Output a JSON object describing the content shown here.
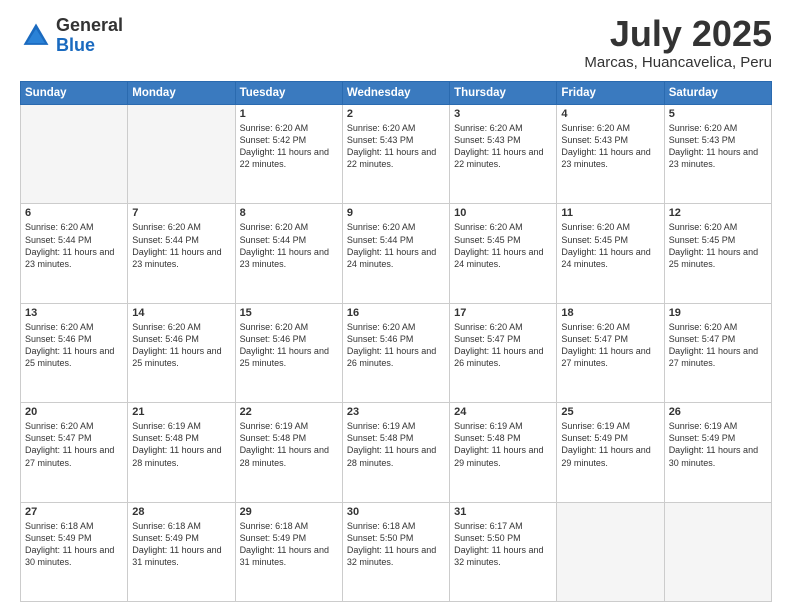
{
  "header": {
    "logo_general": "General",
    "logo_blue": "Blue",
    "month_title": "July 2025",
    "location": "Marcas, Huancavelica, Peru"
  },
  "weekdays": [
    "Sunday",
    "Monday",
    "Tuesday",
    "Wednesday",
    "Thursday",
    "Friday",
    "Saturday"
  ],
  "weeks": [
    [
      {
        "day": "",
        "text": ""
      },
      {
        "day": "",
        "text": ""
      },
      {
        "day": "1",
        "text": "Sunrise: 6:20 AM\nSunset: 5:42 PM\nDaylight: 11 hours and 22 minutes."
      },
      {
        "day": "2",
        "text": "Sunrise: 6:20 AM\nSunset: 5:43 PM\nDaylight: 11 hours and 22 minutes."
      },
      {
        "day": "3",
        "text": "Sunrise: 6:20 AM\nSunset: 5:43 PM\nDaylight: 11 hours and 22 minutes."
      },
      {
        "day": "4",
        "text": "Sunrise: 6:20 AM\nSunset: 5:43 PM\nDaylight: 11 hours and 23 minutes."
      },
      {
        "day": "5",
        "text": "Sunrise: 6:20 AM\nSunset: 5:43 PM\nDaylight: 11 hours and 23 minutes."
      }
    ],
    [
      {
        "day": "6",
        "text": "Sunrise: 6:20 AM\nSunset: 5:44 PM\nDaylight: 11 hours and 23 minutes."
      },
      {
        "day": "7",
        "text": "Sunrise: 6:20 AM\nSunset: 5:44 PM\nDaylight: 11 hours and 23 minutes."
      },
      {
        "day": "8",
        "text": "Sunrise: 6:20 AM\nSunset: 5:44 PM\nDaylight: 11 hours and 23 minutes."
      },
      {
        "day": "9",
        "text": "Sunrise: 6:20 AM\nSunset: 5:44 PM\nDaylight: 11 hours and 24 minutes."
      },
      {
        "day": "10",
        "text": "Sunrise: 6:20 AM\nSunset: 5:45 PM\nDaylight: 11 hours and 24 minutes."
      },
      {
        "day": "11",
        "text": "Sunrise: 6:20 AM\nSunset: 5:45 PM\nDaylight: 11 hours and 24 minutes."
      },
      {
        "day": "12",
        "text": "Sunrise: 6:20 AM\nSunset: 5:45 PM\nDaylight: 11 hours and 25 minutes."
      }
    ],
    [
      {
        "day": "13",
        "text": "Sunrise: 6:20 AM\nSunset: 5:46 PM\nDaylight: 11 hours and 25 minutes."
      },
      {
        "day": "14",
        "text": "Sunrise: 6:20 AM\nSunset: 5:46 PM\nDaylight: 11 hours and 25 minutes."
      },
      {
        "day": "15",
        "text": "Sunrise: 6:20 AM\nSunset: 5:46 PM\nDaylight: 11 hours and 25 minutes."
      },
      {
        "day": "16",
        "text": "Sunrise: 6:20 AM\nSunset: 5:46 PM\nDaylight: 11 hours and 26 minutes."
      },
      {
        "day": "17",
        "text": "Sunrise: 6:20 AM\nSunset: 5:47 PM\nDaylight: 11 hours and 26 minutes."
      },
      {
        "day": "18",
        "text": "Sunrise: 6:20 AM\nSunset: 5:47 PM\nDaylight: 11 hours and 27 minutes."
      },
      {
        "day": "19",
        "text": "Sunrise: 6:20 AM\nSunset: 5:47 PM\nDaylight: 11 hours and 27 minutes."
      }
    ],
    [
      {
        "day": "20",
        "text": "Sunrise: 6:20 AM\nSunset: 5:47 PM\nDaylight: 11 hours and 27 minutes."
      },
      {
        "day": "21",
        "text": "Sunrise: 6:19 AM\nSunset: 5:48 PM\nDaylight: 11 hours and 28 minutes."
      },
      {
        "day": "22",
        "text": "Sunrise: 6:19 AM\nSunset: 5:48 PM\nDaylight: 11 hours and 28 minutes."
      },
      {
        "day": "23",
        "text": "Sunrise: 6:19 AM\nSunset: 5:48 PM\nDaylight: 11 hours and 28 minutes."
      },
      {
        "day": "24",
        "text": "Sunrise: 6:19 AM\nSunset: 5:48 PM\nDaylight: 11 hours and 29 minutes."
      },
      {
        "day": "25",
        "text": "Sunrise: 6:19 AM\nSunset: 5:49 PM\nDaylight: 11 hours and 29 minutes."
      },
      {
        "day": "26",
        "text": "Sunrise: 6:19 AM\nSunset: 5:49 PM\nDaylight: 11 hours and 30 minutes."
      }
    ],
    [
      {
        "day": "27",
        "text": "Sunrise: 6:18 AM\nSunset: 5:49 PM\nDaylight: 11 hours and 30 minutes."
      },
      {
        "day": "28",
        "text": "Sunrise: 6:18 AM\nSunset: 5:49 PM\nDaylight: 11 hours and 31 minutes."
      },
      {
        "day": "29",
        "text": "Sunrise: 6:18 AM\nSunset: 5:49 PM\nDaylight: 11 hours and 31 minutes."
      },
      {
        "day": "30",
        "text": "Sunrise: 6:18 AM\nSunset: 5:50 PM\nDaylight: 11 hours and 32 minutes."
      },
      {
        "day": "31",
        "text": "Sunrise: 6:17 AM\nSunset: 5:50 PM\nDaylight: 11 hours and 32 minutes."
      },
      {
        "day": "",
        "text": ""
      },
      {
        "day": "",
        "text": ""
      }
    ]
  ]
}
